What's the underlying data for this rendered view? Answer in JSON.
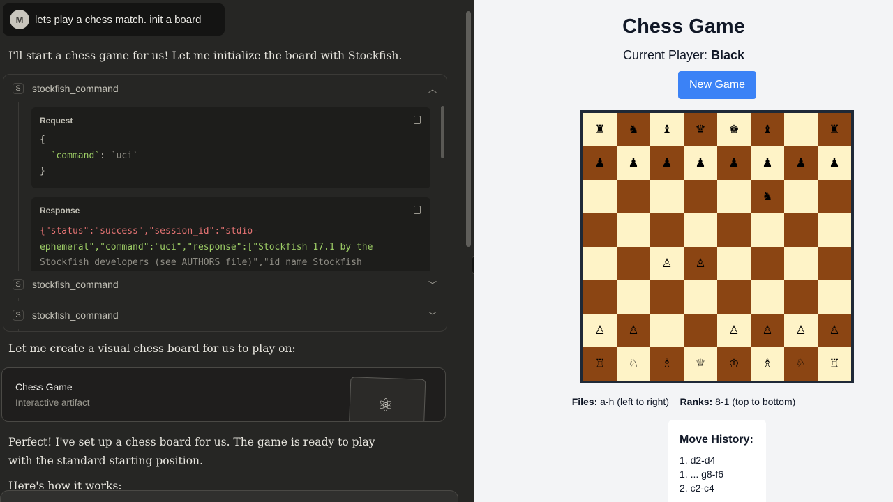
{
  "chat": {
    "user_avatar": "M",
    "user_message": "lets play a chess match. init a board",
    "assistant_intro": "I'll start a chess game for us! Let me initialize the board with Stockfish.",
    "tool_calls": [
      {
        "badge": "S",
        "name": "stockfish_command",
        "expanded": true
      },
      {
        "badge": "S",
        "name": "stockfish_command",
        "expanded": false
      },
      {
        "badge": "S",
        "name": "stockfish_command",
        "expanded": false
      }
    ],
    "request_label": "Request",
    "request_code_open": "{",
    "request_key": "`command`",
    "request_sep": ": ",
    "request_value": "`uci`",
    "request_code_close": "}",
    "response_label": "Response",
    "response_line1": "{\"status\":\"success\",\"session_id\":\"stdio-",
    "response_line2": "ephemeral\",\"command\":\"uci\",\"response\":[\"Stockfish 17.1 by the",
    "response_line3": "Stockfish developers (see AUTHORS file)\",\"id name Stockfish",
    "assistant_board_intro": "Let me create a visual chess board for us to play on:",
    "artifact_title": "Chess Game",
    "artifact_subtitle": "Interactive artifact",
    "artifact_icon": "atom-icon",
    "assistant_ready": "Perfect! I've set up a chess board for us. The game is ready to play with the standard starting position.",
    "assistant_how": "Here's how it works:"
  },
  "game": {
    "title": "Chess Game",
    "current_player_label": "Current Player: ",
    "current_player": "Black",
    "new_game_label": "New Game",
    "files_label": "Files:",
    "files_text": " a-h (left to right)",
    "ranks_label": "Ranks:",
    "ranks_text": " 8-1 (top to bottom)",
    "history_title": "Move History:",
    "moves": [
      "1. d2-d4",
      "1. ... g8-f6",
      "2. c2-c4"
    ],
    "board": [
      [
        "♜",
        "♞",
        "♝",
        "♛",
        "♚",
        "♝",
        "",
        "♜"
      ],
      [
        "♟",
        "♟",
        "♟",
        "♟",
        "♟",
        "♟",
        "♟",
        "♟"
      ],
      [
        "",
        "",
        "",
        "",
        "",
        "♞",
        "",
        ""
      ],
      [
        "",
        "",
        "",
        "",
        "",
        "",
        "",
        ""
      ],
      [
        "",
        "",
        "♙",
        "♙",
        "",
        "",
        "",
        ""
      ],
      [
        "",
        "",
        "",
        "",
        "",
        "",
        "",
        ""
      ],
      [
        "♙",
        "♙",
        "",
        "",
        "♙",
        "♙",
        "♙",
        "♙"
      ],
      [
        "♖",
        "♘",
        "♗",
        "♕",
        "♔",
        "♗",
        "♘",
        "♖"
      ]
    ],
    "colors": {
      "light": "#fef3c7",
      "dark": "#8b4513",
      "button": "#3b82f6"
    }
  }
}
